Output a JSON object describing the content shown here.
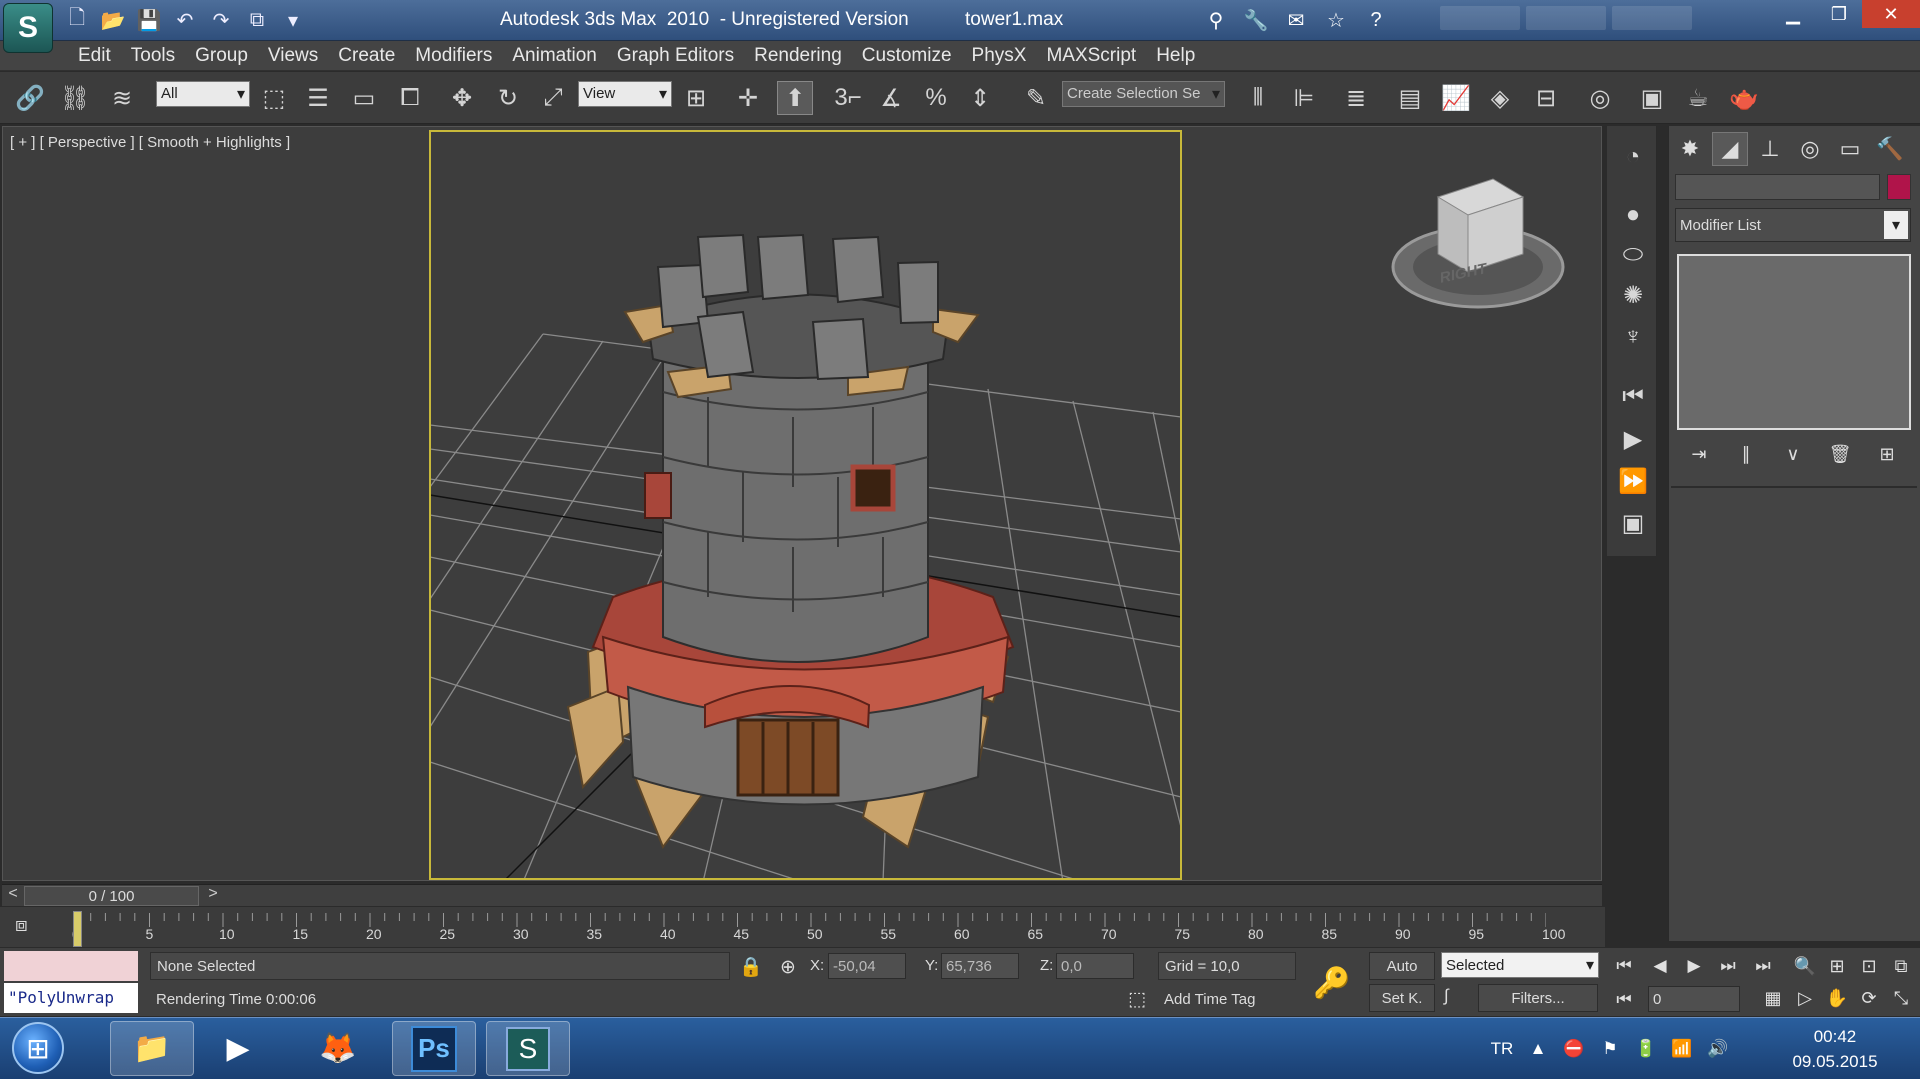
{
  "window": {
    "title": "Autodesk 3ds Max  2010  - Unregistered Version",
    "file": "tower1.max"
  },
  "menus": [
    "Edit",
    "Tools",
    "Group",
    "Views",
    "Create",
    "Modifiers",
    "Animation",
    "Graph Editors",
    "Rendering",
    "Customize",
    "PhysX",
    "MAXScript",
    "Help"
  ],
  "toolbar": {
    "selection_filter": "All",
    "ref_coord_system": "View",
    "named_selection": "Create Selection Se",
    "snap_label": "3"
  },
  "viewport": {
    "label": "[ + ] [ Perspective ] [ Smooth + Highlights ]",
    "viewcube_face": "RIGHT"
  },
  "command_panel": {
    "modifier_list": "Modifier List",
    "object_color": "#b0144a"
  },
  "time_slider": {
    "position": "0 / 100",
    "prev": "<",
    "next": ">"
  },
  "trackbar": {
    "ticks": [
      "0",
      "5",
      "10",
      "15",
      "20",
      "25",
      "30",
      "35",
      "40",
      "45",
      "50",
      "55",
      "60",
      "65",
      "70",
      "75",
      "80",
      "85",
      "90",
      "95",
      "100"
    ]
  },
  "status": {
    "selection": "None Selected",
    "prompt": "Rendering Time  0:00:06",
    "maxscript": "\"PolyUnwrap",
    "x_label": "X:",
    "x_value": "-50,04",
    "y_label": "Y:",
    "y_value": "65,736",
    "z_label": "Z:",
    "z_value": "0,0",
    "grid": "Grid = 10,0",
    "add_time_tag": "Add Time Tag",
    "auto_key": "Auto",
    "set_key": "Set K.",
    "key_filter": "Selected",
    "filters": "Filters...",
    "current_frame": "0"
  },
  "taskbar": {
    "photoshop": "Ps",
    "language": "TR",
    "time": "00:42",
    "date": "09.05.2015"
  }
}
